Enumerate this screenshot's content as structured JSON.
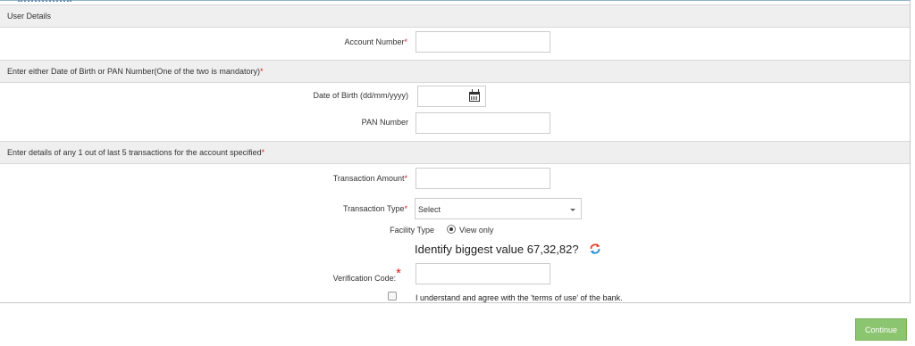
{
  "sections": {
    "user_details": "User Details",
    "dob_pan": "Enter either Date of Birth or PAN Number(One of the two is mandatory)",
    "transactions": "Enter details of any 1 out of last 5 transactions for the account specified"
  },
  "fields": {
    "account_number_label": "Account Number",
    "dob_label": "Date of Birth (dd/mm/yyyy)",
    "pan_label": "PAN Number",
    "transaction_amount_label": "Transaction Amount",
    "transaction_type_label": "Transaction Type",
    "transaction_type_selected": "Select",
    "facility_type_label": "Facility Type",
    "facility_option": "View only",
    "captcha_question": "Identify biggest value 67,32,82?",
    "verification_code_label": "Verification Code:",
    "terms_text": "I understand and agree with the 'terms of use' of the bank."
  },
  "required_mark": "*",
  "actions": {
    "continue_label": "Continue"
  },
  "colors": {
    "required": "#d9241c",
    "continue_button": "#8cc56f",
    "section_bg": "#efefef"
  }
}
